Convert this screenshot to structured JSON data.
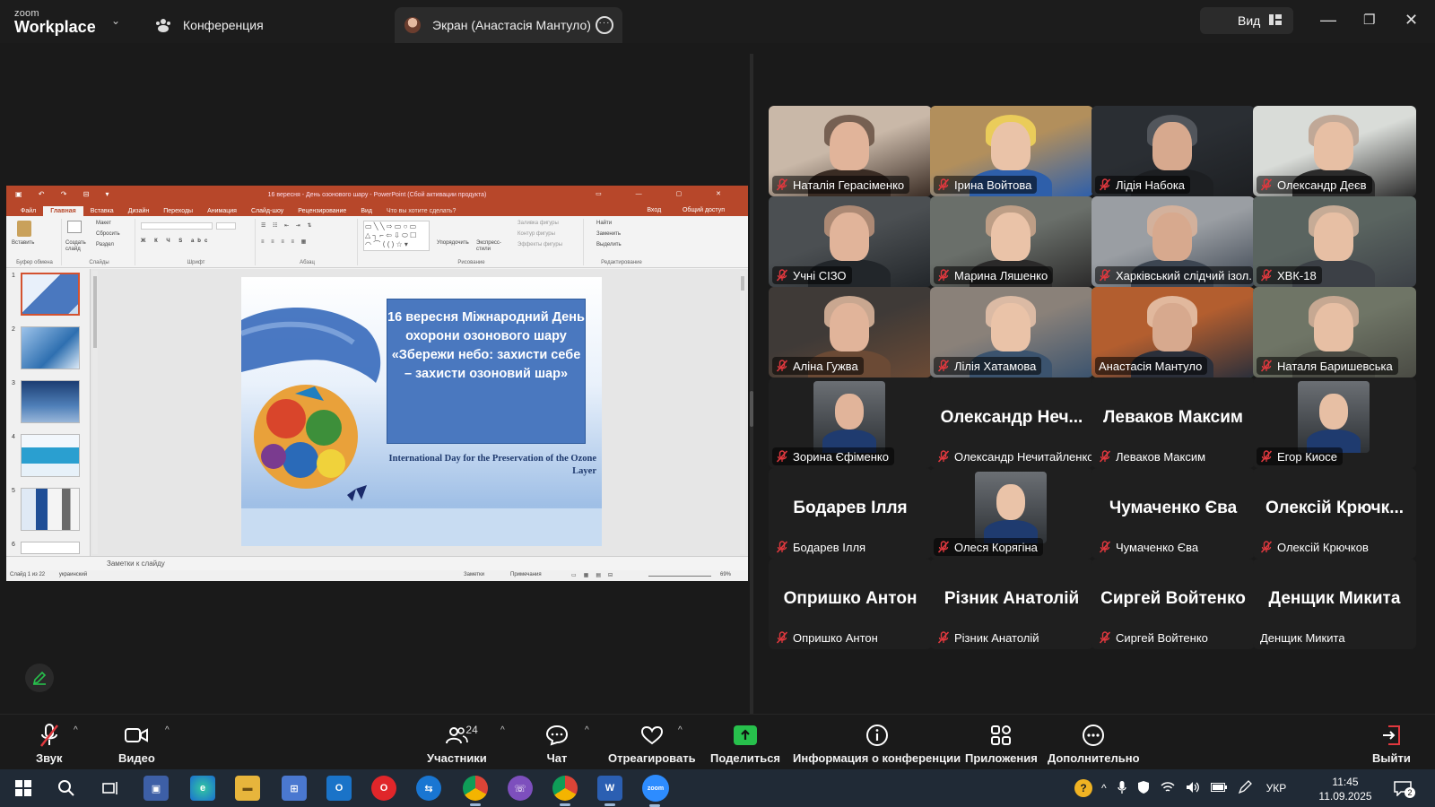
{
  "titlebar": {
    "logo_small": "zoom",
    "logo_big": "Workplace",
    "tab_conference": "Конференция",
    "tab_screen": "Экран (Анастасія Мантуло)",
    "view_label": "Вид"
  },
  "ppt": {
    "window_title": "16 вересня - День озонового шару - PowerPoint (Сбой активации продукта)",
    "menu": [
      "Файл",
      "Главная",
      "Вставка",
      "Дизайн",
      "Переходы",
      "Анимация",
      "Слайд-шоу",
      "Рецензирование",
      "Вид",
      "Что вы хотите сделать?"
    ],
    "menu_right": [
      "Вход",
      "Общий доступ"
    ],
    "ribbon": {
      "paste": "Вставить",
      "create_slide": "Создать слайд",
      "layout": "Макет",
      "reset": "Сбросить",
      "section": "Раздел",
      "arrange": "Упорядочить",
      "quick_styles": "Экспресс-стили",
      "shape_fill": "Заливка фигуры",
      "shape_outline": "Контур фигуры",
      "shape_effects": "Эффекты фигуры",
      "find": "Найти",
      "replace": "Заменить",
      "select": "Выделить",
      "groups": [
        "Буфер обмена",
        "Слайды",
        "Шрифт",
        "Абзац",
        "Рисование",
        "Редактирование"
      ]
    },
    "thumb_numbers": [
      "1",
      "2",
      "3",
      "4",
      "5",
      "6"
    ],
    "slide": {
      "uk_text": "16 вересня Міжнародний День охорони озонового шару «Збережи небо: захисти себе – захисти озоновий шар»",
      "en_text": "International Day for the Preservation of the Ozone Layer"
    },
    "notes_placeholder": "Заметки к слайду",
    "status_left": "Слайд 1 из 22",
    "status_lang": "украинский",
    "status_notes": "Заметки",
    "status_comments": "Примечания",
    "zoom": "69%"
  },
  "gallery": [
    {
      "display": "",
      "label": "Наталія Герасіменко",
      "muted": true,
      "video": true,
      "active": false
    },
    {
      "display": "",
      "label": "Ірина Войтова",
      "muted": true,
      "video": true,
      "active": false
    },
    {
      "display": "",
      "label": "Лідія Набока",
      "muted": true,
      "video": true,
      "active": false
    },
    {
      "display": "",
      "label": "Олександр Деєв",
      "muted": true,
      "video": true,
      "active": false
    },
    {
      "display": "",
      "label": "Учні СІЗО",
      "muted": true,
      "video": true,
      "active": false
    },
    {
      "display": "",
      "label": "Марина Ляшенко",
      "muted": true,
      "video": true,
      "active": false
    },
    {
      "display": "",
      "label": "Харківський слідчий ізол...",
      "muted": true,
      "video": true,
      "active": false
    },
    {
      "display": "",
      "label": "ХВК-18",
      "muted": true,
      "video": true,
      "active": false
    },
    {
      "display": "",
      "label": "Аліна Гужва",
      "muted": true,
      "video": true,
      "active": false
    },
    {
      "display": "",
      "label": "Лілія Хатамова",
      "muted": true,
      "video": true,
      "active": false
    },
    {
      "display": "",
      "label": "Анастасія Мантуло",
      "muted": false,
      "video": true,
      "active": true
    },
    {
      "display": "",
      "label": "Наталя Баришевська",
      "muted": true,
      "video": true,
      "active": false
    },
    {
      "display": "",
      "label": "Зорина Єфіменко",
      "muted": true,
      "video": "photo",
      "active": false
    },
    {
      "display": "Олександр Неч...",
      "label": "Олександр Нечитайленко",
      "muted": true,
      "video": false,
      "active": false
    },
    {
      "display": "Леваков Максим",
      "label": "Леваков Максим",
      "muted": true,
      "video": false,
      "active": false
    },
    {
      "display": "",
      "label": "Егор Киосе",
      "muted": true,
      "video": "photo",
      "active": false
    },
    {
      "display": "Бодарев Ілля",
      "label": "Бодарев Ілля",
      "muted": true,
      "video": false,
      "active": false
    },
    {
      "display": "",
      "label": "Олеся Корягіна",
      "muted": true,
      "video": "photo",
      "active": false
    },
    {
      "display": "Чумаченко Єва",
      "label": "Чумаченко Єва",
      "muted": true,
      "video": false,
      "active": false
    },
    {
      "display": "Олексій Крючк...",
      "label": "Олексій Крючков",
      "muted": true,
      "video": false,
      "active": false
    },
    {
      "display": "Опришко Антон",
      "label": "Опришко Антон",
      "muted": true,
      "video": false,
      "active": false
    },
    {
      "display": "Різник Анатолій",
      "label": "Різник Анатолій",
      "muted": true,
      "video": false,
      "active": false
    },
    {
      "display": "Сиргей Войтенко",
      "label": "Сиргей Войтенко",
      "muted": true,
      "video": false,
      "active": false
    },
    {
      "display": "Денщик Микита",
      "label": "Денщик Микита",
      "muted": false,
      "video": false,
      "active": false
    }
  ],
  "toolbar": {
    "audio": "Звук",
    "video": "Видео",
    "participants": "Участники",
    "participants_count": "24",
    "chat": "Чат",
    "react": "Отреагировать",
    "share": "Поделиться",
    "meeting_info": "Информация о конференции",
    "apps": "Приложения",
    "more": "Дополнительно",
    "leave": "Выйти"
  },
  "taskbar": {
    "lang": "УКР",
    "time": "11:45",
    "date": "11.09.2025",
    "notifications": "2",
    "zoom_label": "zoom",
    "word_label": "W"
  },
  "colors": {
    "active_speaker": "#2fb44a",
    "share_green": "#27c04c",
    "ppt_red": "#b7472a",
    "muted_red": "#e0383e"
  }
}
